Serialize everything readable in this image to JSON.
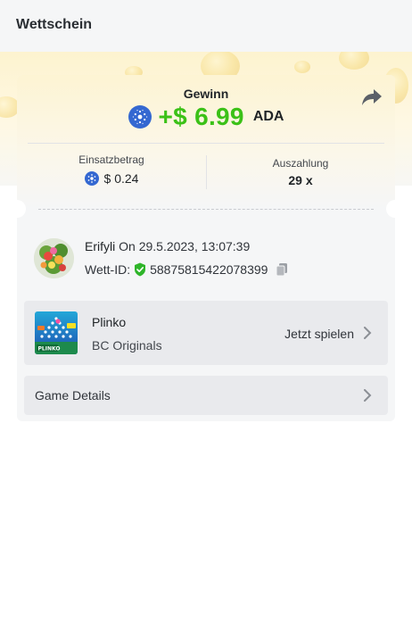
{
  "header": {
    "title": "Wettschein"
  },
  "result": {
    "win_label": "Gewinn",
    "win_amount": "+$ 6.99",
    "currency": "ADA",
    "share_icon": "share-icon"
  },
  "stats": {
    "stake_label": "Einsatzbetrag",
    "stake_value": "$ 0.24",
    "payout_label": "Auszahlung",
    "payout_value": "29 x"
  },
  "bet": {
    "username": "Erifyli",
    "date_text": "On 29.5.2023, 13:07:39",
    "id_label": "Wett-ID:",
    "id_value": "58875815422078399"
  },
  "game": {
    "name": "Plinko",
    "provider": "BC Originals",
    "play_label": "Jetzt spielen",
    "thumb_text": "PLINKO"
  },
  "details": {
    "label": "Game Details"
  },
  "colors": {
    "win": "#3bc117",
    "ada": "#3468d1",
    "verified": "#2fb52a"
  }
}
